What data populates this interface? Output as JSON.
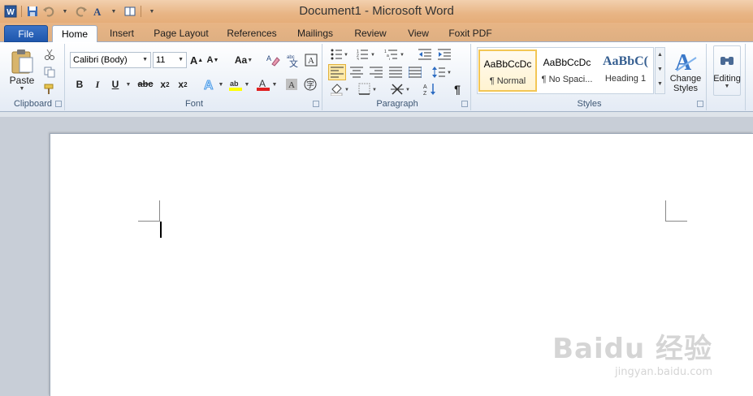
{
  "window": {
    "title": "Document1  -  Microsoft Word"
  },
  "tabs": [
    {
      "label": "File"
    },
    {
      "label": "Home"
    },
    {
      "label": "Insert"
    },
    {
      "label": "Page Layout"
    },
    {
      "label": "References"
    },
    {
      "label": "Mailings"
    },
    {
      "label": "Review"
    },
    {
      "label": "View"
    },
    {
      "label": "Foxit PDF"
    }
  ],
  "ribbon": {
    "clipboard": {
      "label": "Clipboard",
      "paste": "Paste"
    },
    "font": {
      "label": "Font",
      "font_name": "Calibri (Body)",
      "font_size": "11",
      "change_case": "Aa"
    },
    "paragraph": {
      "label": "Paragraph"
    },
    "styles": {
      "label": "Styles",
      "items": [
        {
          "sample": "AaBbCcDc",
          "name": "¶ Normal"
        },
        {
          "sample": "AaBbCcDc",
          "name": "¶ No Spaci..."
        },
        {
          "sample": "AaBbC(",
          "name": "Heading 1"
        }
      ],
      "change_styles": "Change",
      "change_styles2": "Styles"
    },
    "editing": {
      "label": "Editing"
    }
  },
  "watermark": {
    "line1": "Baidu 经验",
    "line2": "jingyan.baidu.com"
  },
  "colors": {
    "file_tab": "#2a62b8",
    "title_bar": "#e8b585",
    "highlight": "#f3c655"
  }
}
